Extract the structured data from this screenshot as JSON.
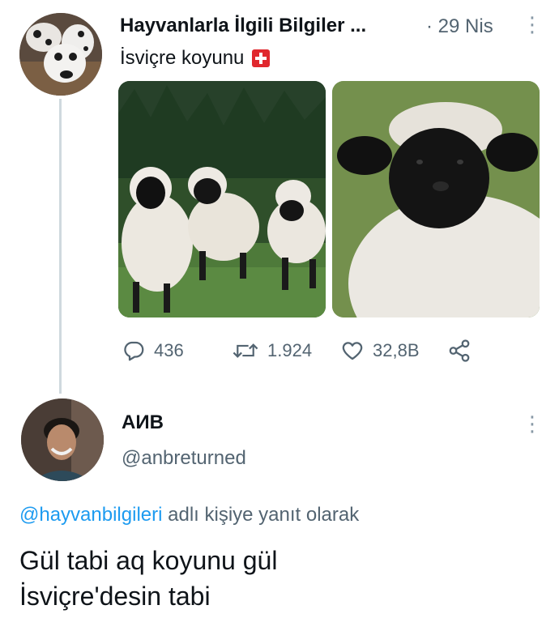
{
  "tweet": {
    "author_name": "Hayvanlarla İlgili Bilgiler ...",
    "date": "· 29 Nis",
    "text": "İsviçre koyunu",
    "flag_icon": "swiss-flag-icon",
    "media": [
      "sheep-group-photo",
      "sheep-closeup-photo"
    ],
    "actions": {
      "replies": "436",
      "retweets": "1.924",
      "likes": "32,8B"
    }
  },
  "reply": {
    "author_name": "AИB",
    "handle": "@anbreturned",
    "reply_to_handle": "@hayvanbilgileri",
    "reply_to_suffix": " adlı kişiye yanıt olarak",
    "line1": "Gül tabi aq koyunu gül",
    "line2": "İsviçre'desin tabi"
  },
  "colors": {
    "accent": "#1d9bf0",
    "muted": "#536471",
    "thread_line": "#cfd9de",
    "swiss_red": "#e0282e"
  }
}
